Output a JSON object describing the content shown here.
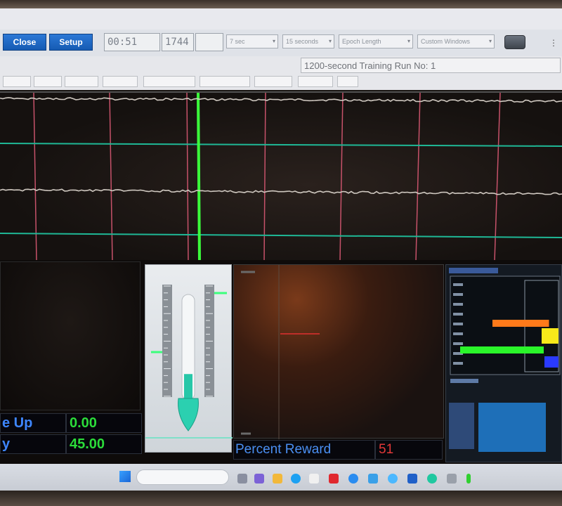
{
  "toolbar": {
    "close_label": "Close",
    "setup_label": "Setup",
    "timer_value": "00:51",
    "count_value": "1744",
    "combo1": "7 sec",
    "combo2": "15 seconds",
    "combo3": "Epoch Length",
    "combo4": "Custom Windows"
  },
  "subtoolbar": {
    "training_run_label": "1200-second Training Run No: 1"
  },
  "readouts": {
    "row1_label": "e Up",
    "row1_value": "0.00",
    "row2_label": "y",
    "row2_value": "45.00"
  },
  "reward": {
    "label": "Percent Reward",
    "value": "51"
  },
  "colors": {
    "accent_blue": "#2b78d6",
    "value_green": "#2bdc3a",
    "value_red": "#e23838",
    "marker_green": "#3bff3b",
    "grid_teal": "#1fb896",
    "grid_pink": "#c7526a",
    "bar_orange": "#ff7a1a",
    "bar_yellow": "#f7e81a",
    "bar_green": "#2af52a"
  },
  "levels": {
    "thermometer_fill": 0.25,
    "threshold_bar_orange": 0.75,
    "threshold_bar_green": 0.85
  },
  "icons": [
    "start-icon",
    "search-box",
    "file-explorer-icon",
    "browser-icon",
    "store-icon",
    "app-icon"
  ]
}
